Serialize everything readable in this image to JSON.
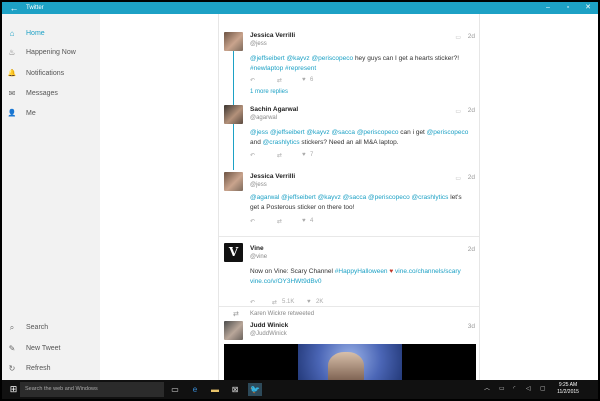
{
  "window": {
    "title": "Twitter",
    "back_icon": "back-arrow-icon"
  },
  "sidebar": {
    "accent": "#1da1c5",
    "items": [
      {
        "label": "Home",
        "icon": "home-icon",
        "glyph": "⌂",
        "active": true
      },
      {
        "label": "Happening Now",
        "icon": "flame-icon",
        "glyph": "♨"
      },
      {
        "label": "Notifications",
        "icon": "bell-icon",
        "glyph": "🔔"
      },
      {
        "label": "Messages",
        "icon": "envelope-icon",
        "glyph": "✉"
      },
      {
        "label": "Me",
        "icon": "person-icon",
        "glyph": "👤"
      }
    ],
    "bottom_items": [
      {
        "label": "Search",
        "icon": "search-icon",
        "glyph": "⌕"
      },
      {
        "label": "New Tweet",
        "icon": "pen-icon",
        "glyph": "✎"
      },
      {
        "label": "Refresh",
        "icon": "refresh-icon",
        "glyph": "↻"
      }
    ]
  },
  "timeline": {
    "tweets": [
      {
        "name": "Jessica Verrilli",
        "handle": "@jess",
        "time": "2d",
        "body_links_1": "@jeffseibert @kayvz @periscopeco",
        "body_text_1": " hey guys can I get a hearts sticker?! ",
        "body_links_2": "#newlaptop #represent",
        "likes": "6",
        "more_replies": "1 more replies"
      },
      {
        "name": "Sachin Agarwal",
        "handle": "@agarwal",
        "time": "2d",
        "body_links_1": "@jess @jeffseibert @kayvz @sacca @periscopeco",
        "body_text_1": " can i get ",
        "body_links_2": "@periscopeco",
        "body_text_2": " and ",
        "body_links_3": "@crashlytics",
        "body_text_3": " stickers? Need an all M&A laptop.",
        "likes": "7"
      },
      {
        "name": "Jessica Verrilli",
        "handle": "@jess",
        "time": "2d",
        "body_links_1": "@agarwal @jeffseibert @kayvz @sacca @periscopeco @crashlytics",
        "body_text_1": " let's get a Posterous sticker on there too!",
        "likes": "4"
      },
      {
        "name": "Vine",
        "handle": "@vine",
        "time": "2d",
        "body_text_1": "Now on Vine: Scary Channel ",
        "body_links_1": "#HappyHalloween",
        "body_text_2": " ",
        "body_links_2": "vine.co/channels/scary",
        "body_links_3": "vine.co/v/OY3HWt9dBv0",
        "retweets": "5.1K",
        "likes": "2K"
      },
      {
        "retweeted_by": "Karen Wickre retweeted",
        "name": "Judd Winick",
        "handle": "@JuddWinick",
        "time": "3d"
      }
    ]
  },
  "taskbar": {
    "search_placeholder": "Search the web and Windows",
    "time": "9:25 AM",
    "date": "11/2/2015"
  }
}
